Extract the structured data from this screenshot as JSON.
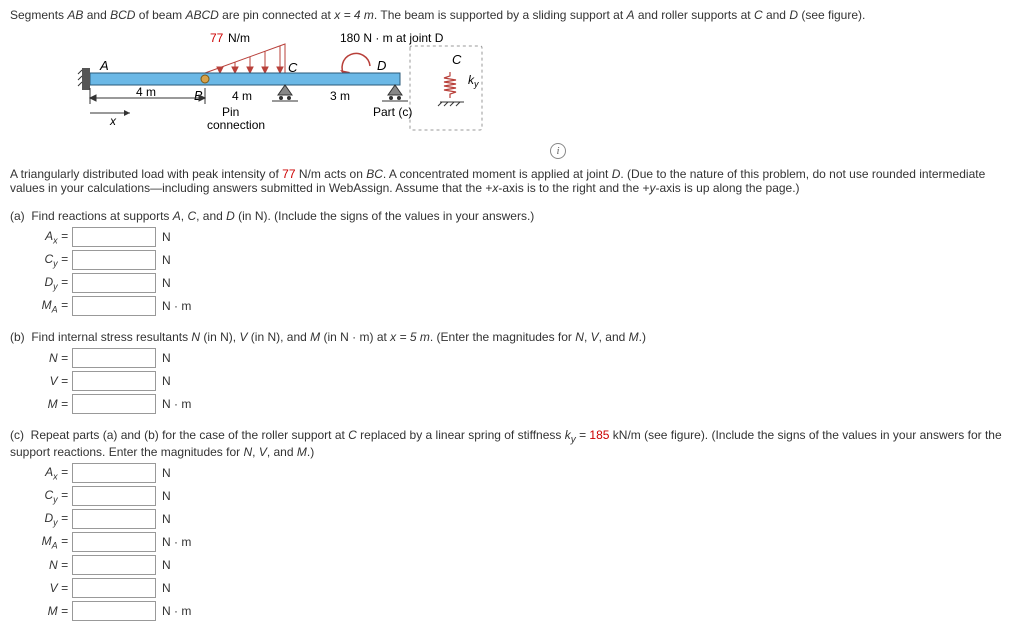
{
  "intro1a": "Segments ",
  "intro1b": " and ",
  "intro1c": " of beam ",
  "intro1d": " are pin connected at ",
  "intro1e": ". The beam is supported by a sliding support at ",
  "intro1f": " and roller supports at ",
  "intro1g": " and ",
  "intro1h": " (see figure).",
  "seg1": "AB",
  "seg2": "BCD",
  "beam": "ABCD",
  "xeq": "x = 4 m",
  "ptA": "A",
  "ptC": "C",
  "ptD": "D",
  "load": "77",
  "loadUnit": " N/m",
  "moment": "180 N · m at joint D",
  "fig": {
    "A": "A",
    "B": "B",
    "C": "C",
    "D": "D",
    "x": "x",
    "d1": "4 m",
    "d2": "4 m",
    "d3": "3 m",
    "pin": "Pin",
    "conn": "connection",
    "part": "Part (c)",
    "ky": "k",
    "kysub": "y",
    "C2": "C"
  },
  "para2a": "A triangularly distributed load with peak intensity of ",
  "para2b": " N/m acts on ",
  "para2c": ". A concentrated moment is applied at joint ",
  "para2d": ". (Due to the nature of this problem, do not use rounded intermediate values in your calculations—including answers submitted in WebAssign. Assume that the +",
  "para2e": "-axis is to the right and the +",
  "para2f": "-axis is up along the page.)",
  "load2": "77",
  "bc": "BC",
  "d2j": "D",
  "xax": "x",
  "yax": "y",
  "a": {
    "label": "(a)",
    "text": "Find reactions at supports ",
    "t2": ", ",
    "t3": ", and ",
    "t4": " (in N). (Include the signs of the values in your answers.)",
    "A": "A",
    "C": "C",
    "D": "D",
    "r": [
      {
        "v": "A",
        "s": "x",
        "u": "N"
      },
      {
        "v": "C",
        "s": "y",
        "u": "N"
      },
      {
        "v": "D",
        "s": "y",
        "u": "N"
      },
      {
        "v": "M",
        "s": "A",
        "u": "N · m"
      }
    ]
  },
  "b": {
    "label": "(b)",
    "text": "Find internal stress resultants ",
    "t2": " (in N), ",
    "t3": " (in N), and ",
    "t4": " (in N · m) at ",
    "t5": ". (Enter the magnitudes for ",
    "t6": ", ",
    "t7": ", and ",
    "t8": ".)",
    "N": "N",
    "V": "V",
    "M": "M",
    "x5": "x = 5 m",
    "r": [
      {
        "v": "N",
        "s": "",
        "u": "N"
      },
      {
        "v": "V",
        "s": "",
        "u": "N"
      },
      {
        "v": "M",
        "s": "",
        "u": "N · m"
      }
    ]
  },
  "c": {
    "label": "(c)",
    "text": "Repeat parts (a) and (b) for the case of the roller support at ",
    "t2": " replaced by a linear spring of stiffness ",
    "t3": " = ",
    "t4": " kN/m (see figure). (Include the signs of the values in your answers for the support reactions. Enter the magnitudes for ",
    "t5": ", ",
    "t6": ", and ",
    "t7": ".)",
    "C": "C",
    "k": "k",
    "ks": "y",
    "kv": "185",
    "N": "N",
    "V": "V",
    "M": "M",
    "r": [
      {
        "v": "A",
        "s": "x",
        "u": "N"
      },
      {
        "v": "C",
        "s": "y",
        "u": "N"
      },
      {
        "v": "D",
        "s": "y",
        "u": "N"
      },
      {
        "v": "M",
        "s": "A",
        "u": "N · m"
      },
      {
        "v": "N",
        "s": "",
        "u": "N"
      },
      {
        "v": "V",
        "s": "",
        "u": "N"
      },
      {
        "v": "M",
        "s": "",
        "u": "N · m"
      }
    ]
  }
}
